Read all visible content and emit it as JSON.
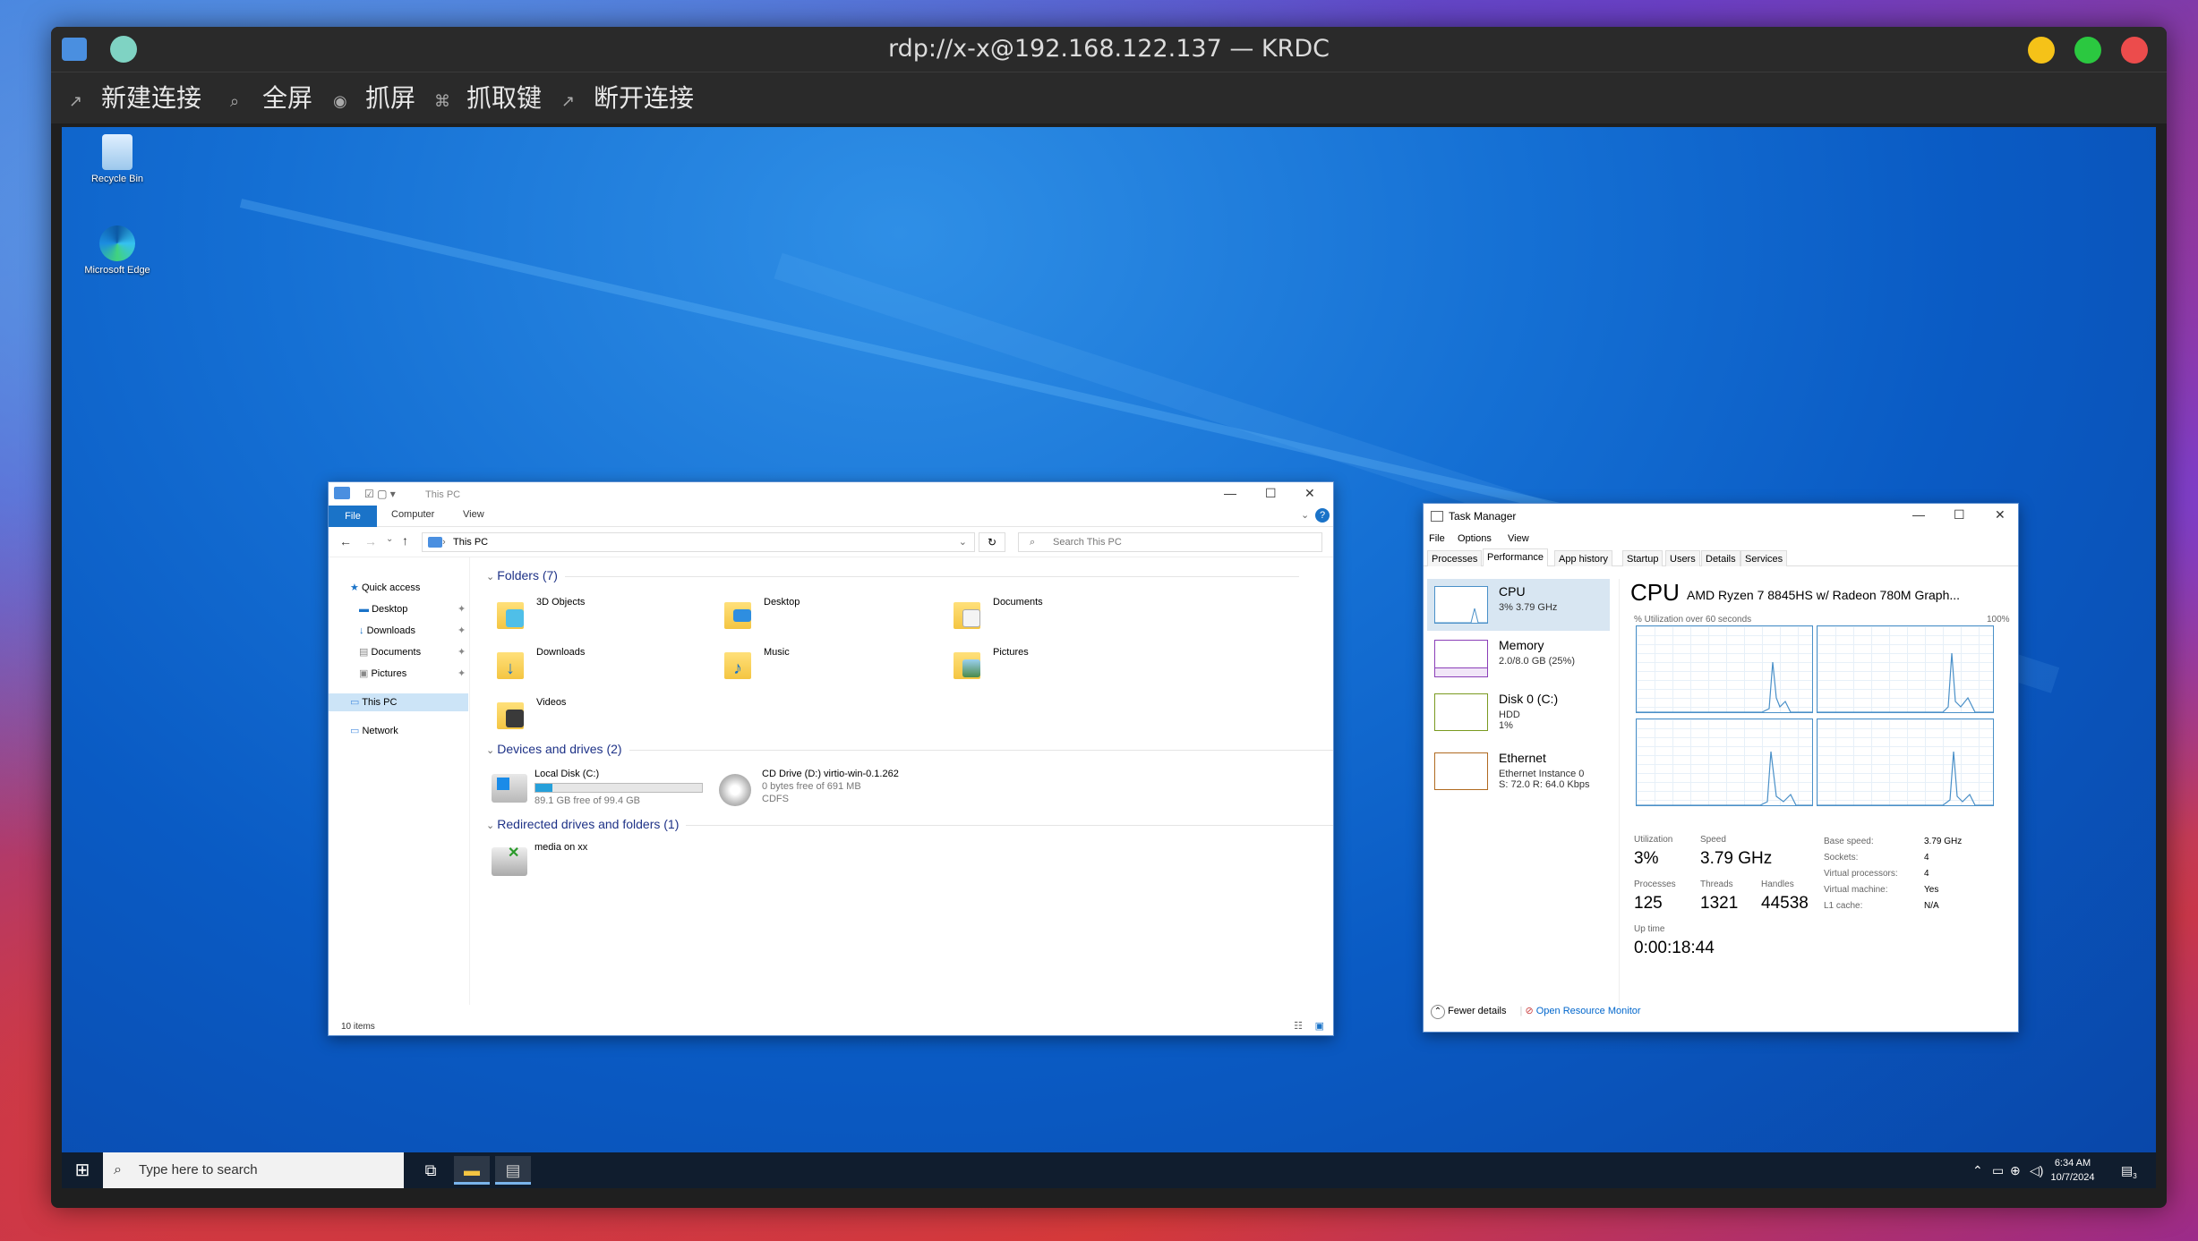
{
  "krdc": {
    "title": "rdp://x-x@192.168.122.137 — KRDC",
    "toolbar": [
      {
        "icon": "↗",
        "label": "新建连接"
      },
      {
        "icon": "⌕",
        "label": "全屏"
      },
      {
        "icon": "◉",
        "label": "抓屏"
      },
      {
        "icon": "⌘",
        "label": "抓取键"
      },
      {
        "icon": "↗",
        "label": "断开连接"
      }
    ]
  },
  "desktop": {
    "icons": [
      {
        "label": "Recycle Bin"
      },
      {
        "label": "Microsoft Edge"
      }
    ]
  },
  "explorer": {
    "title": "This PC",
    "ribbon_tabs": [
      "File",
      "Computer",
      "View"
    ],
    "address": "This PC",
    "search_placeholder": "Search This PC",
    "nav": [
      "Quick access",
      "Desktop",
      "Downloads",
      "Documents",
      "Pictures",
      "This PC",
      "Network"
    ],
    "groups": {
      "folders": "Folders (7)",
      "devices": "Devices and drives (2)",
      "redirected": "Redirected drives and folders (1)"
    },
    "folders": [
      "3D Objects",
      "Desktop",
      "Documents",
      "Downloads",
      "Music",
      "Pictures",
      "Videos"
    ],
    "drives": [
      {
        "name": "Local Disk (C:)",
        "free": "89.1 GB free of 99.4 GB",
        "used_fraction": 0.1
      },
      {
        "name": "CD Drive (D:) virtio-win-0.1.262",
        "free": "0 bytes free of 691 MB",
        "fs": "CDFS"
      }
    ],
    "redirected_item": "media on xx",
    "status": "10 items"
  },
  "taskmgr": {
    "title": "Task Manager",
    "menu": [
      "File",
      "Options",
      "View"
    ],
    "tabs": [
      "Processes",
      "Performance",
      "App history",
      "Startup",
      "Users",
      "Details",
      "Services"
    ],
    "side": {
      "cpu": {
        "title": "CPU",
        "sub": "3% 3.79 GHz"
      },
      "memory": {
        "title": "Memory",
        "sub": "2.0/8.0 GB (25%)"
      },
      "disk": {
        "title": "Disk 0 (C:)",
        "sub1": "HDD",
        "sub2": "1%"
      },
      "ethernet": {
        "title": "Ethernet",
        "sub1": "Ethernet Instance 0",
        "sub2": "S: 72.0 R: 64.0 Kbps"
      }
    },
    "main": {
      "heading": "CPU",
      "cpu_name": "AMD Ryzen 7 8845HS w/ Radeon 780M Graph...",
      "util_label": "% Utilization over 60 seconds",
      "util_max": "100%",
      "stats": {
        "utilization_label": "Utilization",
        "utilization": "3%",
        "speed_label": "Speed",
        "speed": "3.79 GHz",
        "processes_label": "Processes",
        "processes": "125",
        "threads_label": "Threads",
        "threads": "1321",
        "handles_label": "Handles",
        "handles": "44538",
        "uptime_label": "Up time",
        "uptime": "0:00:18:44"
      },
      "specs": [
        {
          "k": "Base speed:",
          "v": "3.79 GHz"
        },
        {
          "k": "Sockets:",
          "v": "4"
        },
        {
          "k": "Virtual processors:",
          "v": "4"
        },
        {
          "k": "Virtual machine:",
          "v": "Yes"
        },
        {
          "k": "L1 cache:",
          "v": "N/A"
        }
      ]
    },
    "fewer": "Fewer details",
    "resmon": "Open Resource Monitor"
  },
  "taskbar": {
    "search": "Type here to search",
    "time": "6:34 AM",
    "date": "10/7/2024",
    "notif_count": "3"
  },
  "colors": {
    "accent": "#1a73c8",
    "cpu_graph": "#4a90c8",
    "memory_graph": "#8b3fb8",
    "disk_graph": "#7a9a20",
    "ethernet_graph": "#b06a20"
  }
}
